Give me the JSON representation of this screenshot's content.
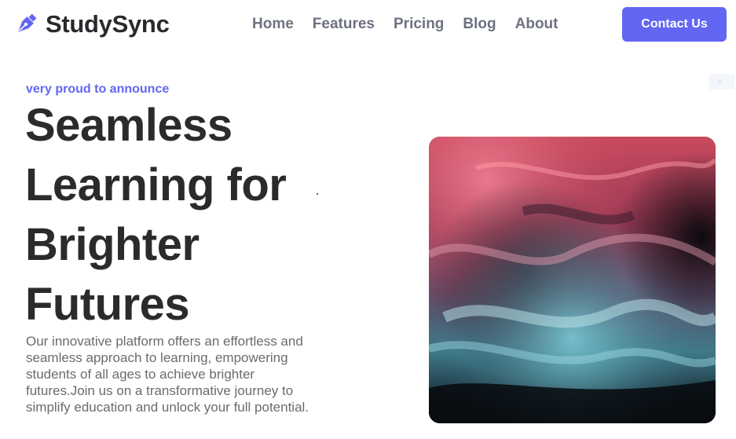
{
  "brand": {
    "name": "StudySync",
    "logo_icon": "pen-nib-icon",
    "accent_color": "#6366f1"
  },
  "nav": {
    "items": [
      {
        "label": "Home"
      },
      {
        "label": "Features"
      },
      {
        "label": "Pricing"
      },
      {
        "label": "Blog"
      },
      {
        "label": "About"
      }
    ]
  },
  "header": {
    "cta_label": "Contact Us"
  },
  "hero": {
    "eyebrow": "very proud to announce",
    "headline_lines": [
      "Seamless",
      "Learning for",
      "Brighter",
      "Futures"
    ],
    "description": "Our innovative platform offers an effortless and seamless approach to learning, empowering students of all ages to achieve brighter futures.Join us on a transformative journey to simplify education and unlock your full potential.",
    "image_icon": "abstract-ink-image"
  }
}
